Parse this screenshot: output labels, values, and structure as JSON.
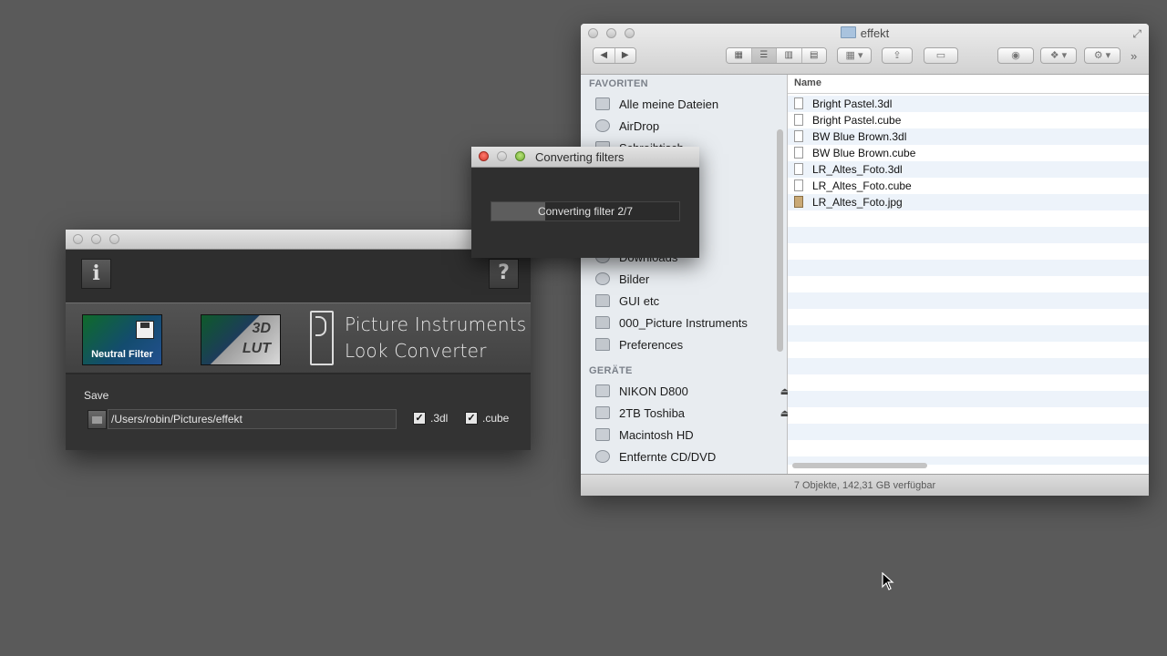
{
  "finder": {
    "title": "effekt",
    "sidebar": {
      "favorites_header": "FAVORITEN",
      "favorites": [
        {
          "label": "Alle meine Dateien",
          "icon": "all-files-icon"
        },
        {
          "label": "AirDrop",
          "icon": "airdrop-icon"
        },
        {
          "label": "Schreibtisch",
          "icon": "desktop-icon"
        },
        {
          "label": "Downloads",
          "icon": "downloads-icon"
        },
        {
          "label": "Bilder",
          "icon": "camera-icon"
        },
        {
          "label": "GUI etc",
          "icon": "folder-icon"
        },
        {
          "label": "000_Picture Instruments",
          "icon": "folder-icon"
        },
        {
          "label": "Preferences",
          "icon": "folder-icon"
        }
      ],
      "devices_header": "GERÄTE",
      "devices": [
        {
          "label": "NIKON D800",
          "icon": "drive-icon",
          "eject": true
        },
        {
          "label": "2TB Toshiba",
          "icon": "drive-icon",
          "eject": true
        },
        {
          "label": "Macintosh HD",
          "icon": "drive-icon",
          "eject": false
        },
        {
          "label": "Entfernte CD/DVD",
          "icon": "disc-icon",
          "eject": false
        }
      ]
    },
    "list": {
      "column_name": "Name",
      "files": [
        {
          "name": "Bright Pastel.3dl",
          "type": "document"
        },
        {
          "name": "Bright Pastel.cube",
          "type": "document"
        },
        {
          "name": "BW Blue Brown.3dl",
          "type": "document"
        },
        {
          "name": "BW Blue Brown.cube",
          "type": "document"
        },
        {
          "name": "LR_Altes_Foto.3dl",
          "type": "document"
        },
        {
          "name": "LR_Altes_Foto.cube",
          "type": "document"
        },
        {
          "name": "LR_Altes_Foto.jpg",
          "type": "image"
        }
      ]
    },
    "status": "7 Objekte, 142,31 GB verfügbar"
  },
  "converter": {
    "neutral_filter_label": "Neutral Filter",
    "lut_line1": "3D",
    "lut_line2": "LUT",
    "brand_line1": "Picture Instruments",
    "brand_line2": "Look Converter",
    "info_glyph": "i",
    "help_glyph": "?",
    "save_label": "Save",
    "save_path": "/Users/robin/Pictures/effekt",
    "format_3dl_label": ".3dl",
    "format_3dl_checked": true,
    "format_cube_label": ".cube",
    "format_cube_checked": true
  },
  "dialog": {
    "title": "Converting filters",
    "progress_text": "Converting filter 2/7",
    "progress_fraction": 0.2857
  }
}
